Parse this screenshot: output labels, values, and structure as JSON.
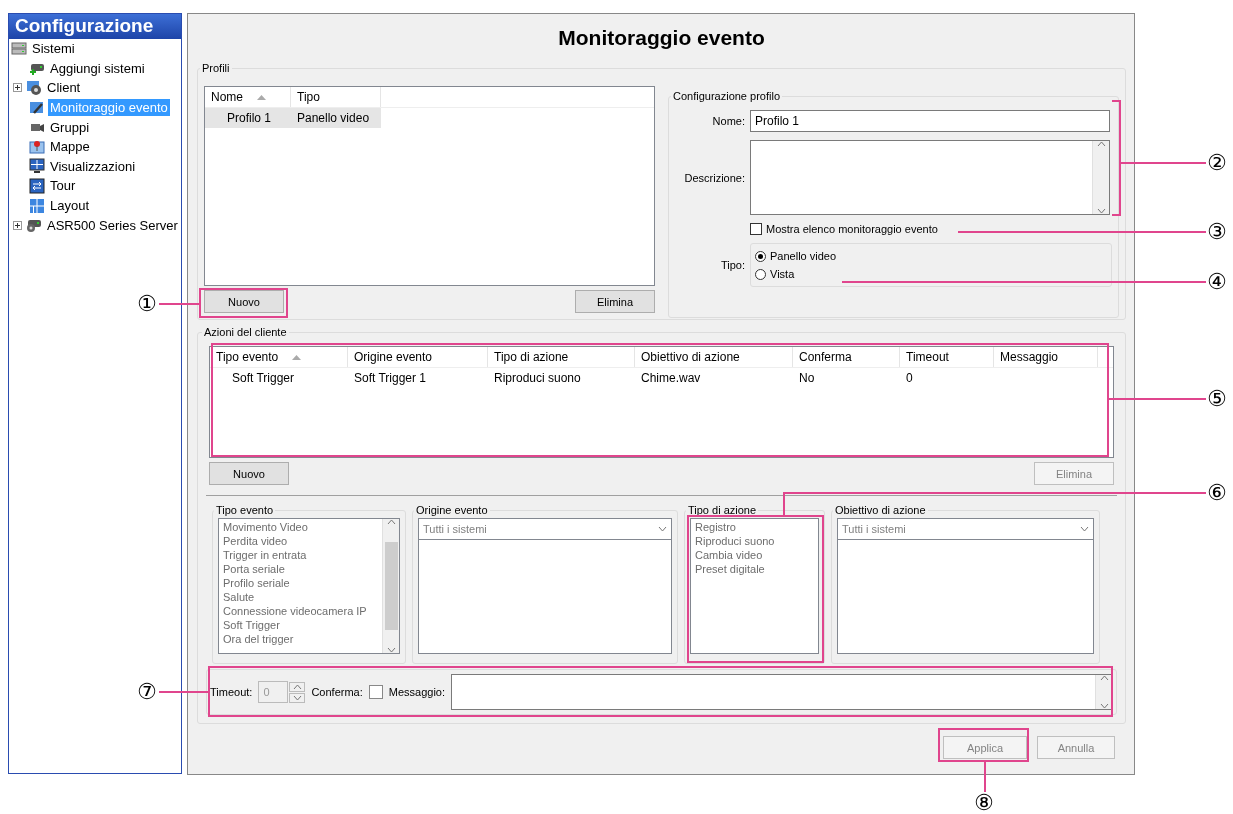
{
  "sidebar": {
    "title": "Configurazione",
    "tree": [
      {
        "label": "Sistemi",
        "kind": "system",
        "selected": false,
        "children": [
          {
            "label": "Aggiungi sistemi",
            "kind": "add",
            "selected": false
          },
          {
            "label": "Client",
            "kind": "client",
            "selected": false,
            "expanded": false
          },
          {
            "label": "Monitoraggio evento",
            "kind": "monitor",
            "selected": true
          },
          {
            "label": "Gruppi",
            "kind": "camera",
            "selected": false
          },
          {
            "label": "Mappe",
            "kind": "map",
            "selected": false
          },
          {
            "label": "Visualizzazioni",
            "kind": "display",
            "selected": false
          },
          {
            "label": "Tour",
            "kind": "tour",
            "selected": false
          },
          {
            "label": "Layout",
            "kind": "layout",
            "selected": false
          },
          {
            "label": "ASR500 Series Server",
            "kind": "server",
            "selected": false,
            "expanded": false
          }
        ]
      }
    ]
  },
  "page_title": "Monitoraggio evento",
  "profiles": {
    "legend": "Profili",
    "columns": [
      {
        "label": "Nome",
        "sorted": true
      },
      {
        "label": "Tipo",
        "sorted": false
      }
    ],
    "rows": [
      {
        "cells": [
          "Profilo 1",
          "Panello video"
        ],
        "selected": true
      }
    ],
    "buttons": [
      {
        "label": "Nuovo",
        "disabled": false
      },
      {
        "label": "Elimina",
        "disabled": false
      }
    ]
  },
  "profile_config": {
    "legend": "Configurazione profilo",
    "name_label": "Nome:",
    "name_value": "Profilo 1",
    "description_label": "Descrizione:",
    "show_list": {
      "label": "Mostra elenco monitoraggio evento",
      "checked": false
    },
    "type_label": "Tipo:",
    "type_options": [
      {
        "label": "Panello video",
        "selected": true
      },
      {
        "label": "Vista",
        "selected": false
      }
    ]
  },
  "client_actions": {
    "legend": "Azioni del cliente",
    "columns": [
      {
        "label": "Tipo evento",
        "sorted": true
      },
      {
        "label": "Origine evento",
        "sorted": false
      },
      {
        "label": "Tipo di azione",
        "sorted": false
      },
      {
        "label": "Obiettivo di azione",
        "sorted": false
      },
      {
        "label": "Conferma",
        "sorted": false
      },
      {
        "label": "Timeout",
        "sorted": false
      },
      {
        "label": "Messaggio",
        "sorted": false
      }
    ],
    "rows": [
      {
        "cells": [
          "Soft Trigger",
          "Soft Trigger 1",
          "Riproduci suono",
          "Chime.wav",
          "No",
          "0",
          ""
        ],
        "selected": false
      }
    ],
    "buttons": [
      {
        "label": "Nuovo",
        "disabled": false
      },
      {
        "label": "Elimina",
        "disabled": true
      }
    ]
  },
  "pickers": [
    {
      "legend": "Tipo evento",
      "kind": "list",
      "disabled": true,
      "items": [
        "Movimento Video",
        "Perdita video",
        "Trigger in entrata",
        "Porta seriale",
        "Profilo seriale",
        "Salute",
        "Connessione videocamera IP",
        "Soft Trigger",
        "Ora del trigger"
      ]
    },
    {
      "legend": "Origine evento",
      "kind": "dropdown",
      "disabled": true,
      "placeholder": "Tutti i sistemi"
    },
    {
      "legend": "Tipo di azione",
      "kind": "list",
      "disabled": true,
      "items": [
        "Registro",
        "Riproduci suono",
        "Cambia video",
        "Preset digitale"
      ]
    },
    {
      "legend": "Obiettivo di azione",
      "kind": "dropdown",
      "disabled": true,
      "placeholder": "Tutti i sistemi"
    }
  ],
  "details": {
    "timeout_label": "Timeout:",
    "timeout_value": "0",
    "timeout_disabled": true,
    "confirm_label": "Conferma:",
    "confirm_checked": false,
    "message_label": "Messaggio:"
  },
  "footer_buttons": [
    {
      "label": "Applica",
      "disabled": true
    },
    {
      "label": "Annulla",
      "disabled": true
    }
  ],
  "callouts": [
    {
      "label": "①"
    },
    {
      "label": "②"
    },
    {
      "label": "③"
    },
    {
      "label": "④"
    },
    {
      "label": "⑤"
    },
    {
      "label": "⑥"
    },
    {
      "label": "⑦"
    },
    {
      "label": "⑧"
    }
  ]
}
